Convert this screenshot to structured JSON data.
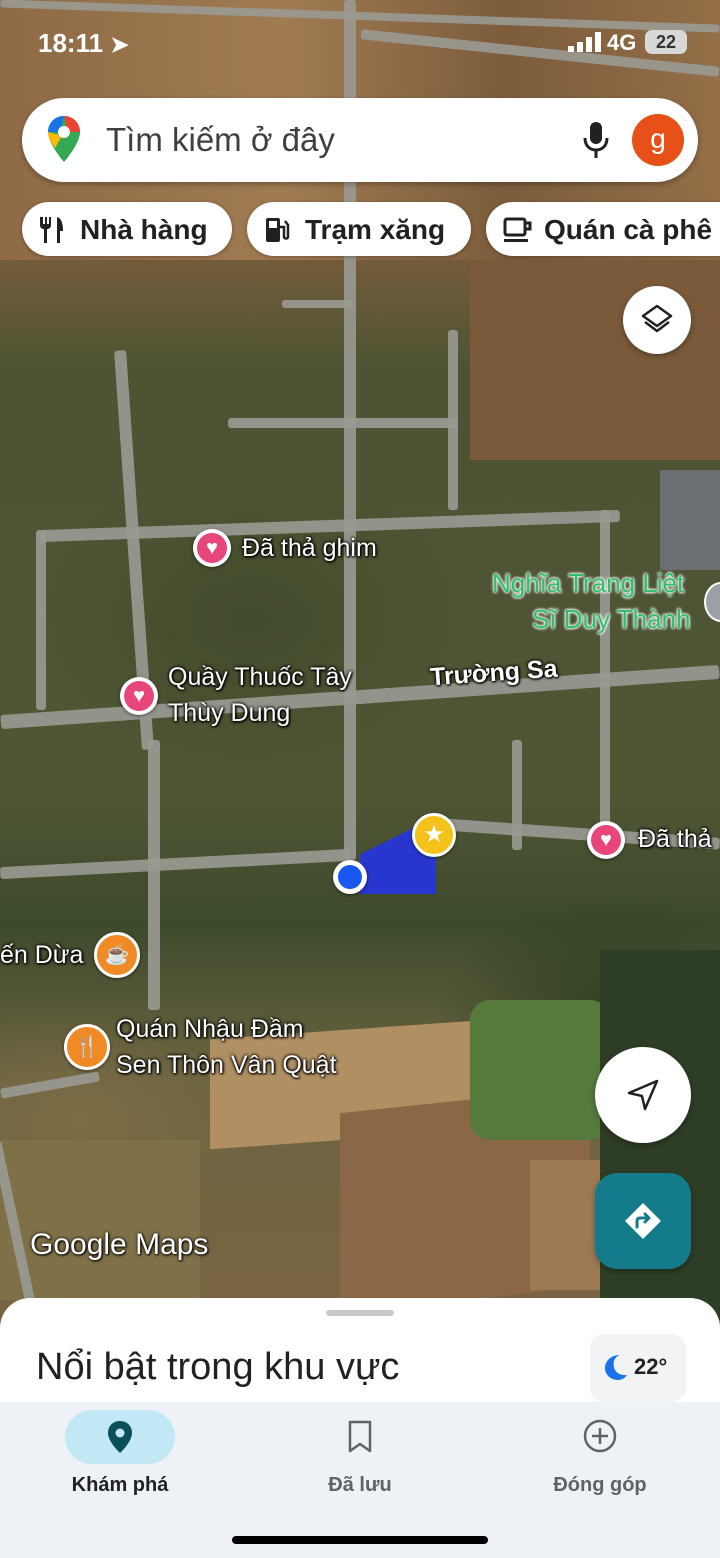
{
  "status": {
    "time": "18:11",
    "network": "4G",
    "battery": "22"
  },
  "search": {
    "placeholder": "Tìm kiếm ở đây",
    "avatar_letter": "g"
  },
  "chips": [
    {
      "label": "Nhà hàng",
      "icon": "fork-knife-icon"
    },
    {
      "label": "Trạm xăng",
      "icon": "gas-station-icon"
    },
    {
      "label": "Quán cà phê",
      "icon": "coffee-cup-icon"
    }
  ],
  "map": {
    "labels": {
      "pinned_1": "Đã thả ghim",
      "cemetery_line1": "Nghĩa Trang Liệt",
      "cemetery_line2": "Sĩ Duy Thành",
      "pharmacy_line1": "Quầy Thuốc Tây",
      "pharmacy_line2": "Thùy Dung",
      "street": "Trường Sa",
      "pinned_2": "Đã thả",
      "cafe": "ến Dừa",
      "bar_line1": "Quán Nhậu Đầm",
      "bar_line2": "Sen Thôn Vân Quật"
    },
    "attribution": "Google Maps"
  },
  "sheet": {
    "title": "Nổi bật trong khu vực",
    "temperature": "22°"
  },
  "nav": [
    {
      "label": "Khám phá",
      "icon": "explore-pin-icon",
      "active": true
    },
    {
      "label": "Đã lưu",
      "icon": "bookmark-icon",
      "active": false
    },
    {
      "label": "Đóng góp",
      "icon": "add-circle-icon",
      "active": false
    }
  ],
  "colors": {
    "accent": "#00897b",
    "directions_button": "#137b8a",
    "location_dot": "#1a56f0",
    "pin_heart": "#e8457a",
    "avatar": "#e8501a"
  }
}
